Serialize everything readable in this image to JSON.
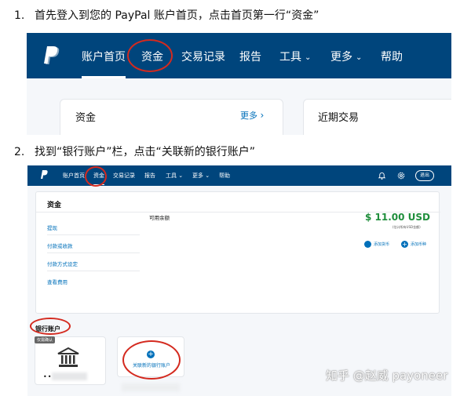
{
  "step1": {
    "number": "1.",
    "text": "首先登入到您的 PayPal 账户首页，点击首页第一行“资金”",
    "nav": [
      "账户首页",
      "资金",
      "交易记录",
      "报告",
      "工具",
      "更多",
      "帮助"
    ],
    "funds_card_title": "资金",
    "funds_card_more": "更多",
    "recent_card_title": "近期交易"
  },
  "step2": {
    "number": "2.",
    "text": "找到“银行账户”栏，点击“关联新的银行账户”",
    "nav": [
      "账户首页",
      "资金",
      "交易记录",
      "报告",
      "工具",
      "更多",
      "帮助"
    ],
    "logout": "退出",
    "section_title": "资金",
    "side_links": [
      "提现",
      "付款或收款",
      "付款方式设定",
      "查看费用"
    ],
    "available_label": "可用余额",
    "balance": "$ 11.00 USD",
    "balance_note": "(估计所有USD金额)",
    "actions": [
      "添加货币",
      "添加币种"
    ],
    "bank_section_title": "银行账户",
    "bank_badge": "仅需确认",
    "bank_masked": "••",
    "link_bank_label": "关联新的银行账户"
  },
  "watermark": "知乎 @赵威 payoneer",
  "colors": {
    "nav": "#00457c",
    "link": "#0070ba",
    "balance": "#1f8e3c",
    "highlight": "#d42a1f"
  },
  "icons": [
    "paypal-logo-icon",
    "chevron-down-icon",
    "chevron-right-icon",
    "bell-icon",
    "gear-icon",
    "bank-icon",
    "plus-icon",
    "refresh-icon"
  ]
}
